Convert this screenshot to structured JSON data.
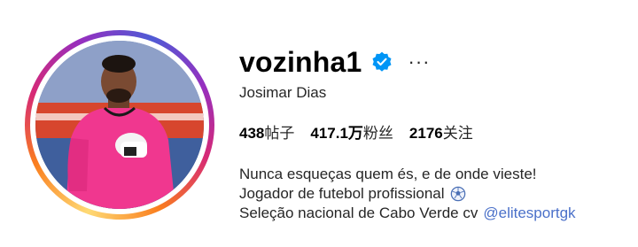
{
  "profile": {
    "username": "vozinha1",
    "full_name": "Josimar Dias",
    "verified": true,
    "verified_icon": "verified-badge-icon",
    "more_icon": "more-options-icon"
  },
  "stats": [
    {
      "number": "438",
      "label": "帖子"
    },
    {
      "number": "417.1万",
      "label": "粉丝"
    },
    {
      "number": "2176",
      "label": "关注"
    }
  ],
  "bio": {
    "line1": "Nunca esqueças quem és, e de onde vieste!",
    "line2": "Jogador de futebol profissional",
    "line2_icon": "soccer-ball-icon",
    "line3": "Seleção nacional de Cabo Verde cv",
    "mention": "@elitesportgk"
  },
  "colors": {
    "verified_blue": "#0095f6",
    "mention_blue": "#4a70c9",
    "jersey_pink": "#f0378f"
  }
}
